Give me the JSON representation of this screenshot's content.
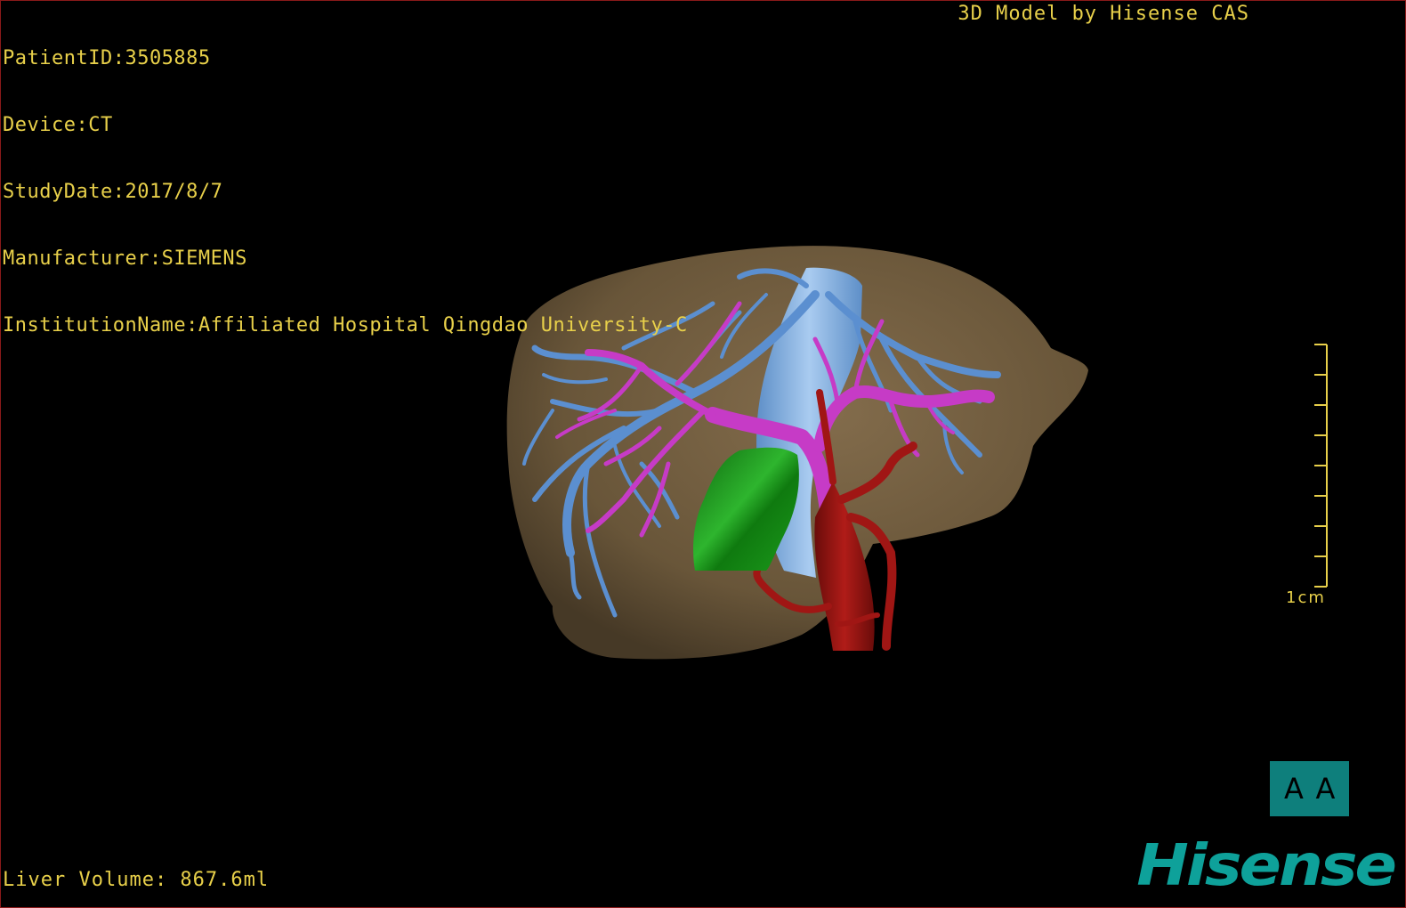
{
  "overlay": {
    "patient_id": "PatientID:3505885",
    "device": "Device:CT",
    "study_date": "StudyDate:2017/8/7",
    "manufacturer": "Manufacturer:SIEMENS",
    "institution": "InstitutionName:Affiliated Hospital Qingdao University-C",
    "credit": "3D Model by Hisense CAS",
    "liver_volume": "Liver Volume: 867.6ml"
  },
  "scale": {
    "label": "1cm"
  },
  "view_toggle": {
    "left_glyph": "A",
    "right_glyph": "A",
    "icon": "orientation-toggle-icon"
  },
  "brand": {
    "logo_text": "Hisense"
  },
  "colors": {
    "overlay_text": "#e8d04a",
    "liver": "#6e5a3c",
    "hepatic_vein": "#5b8fd0",
    "portal_vein": "#c63bc6",
    "artery": "#9a1412",
    "tumor": "#1f8f1f",
    "brand": "#0ea19a",
    "viewport_border": "#8a1a1a"
  }
}
